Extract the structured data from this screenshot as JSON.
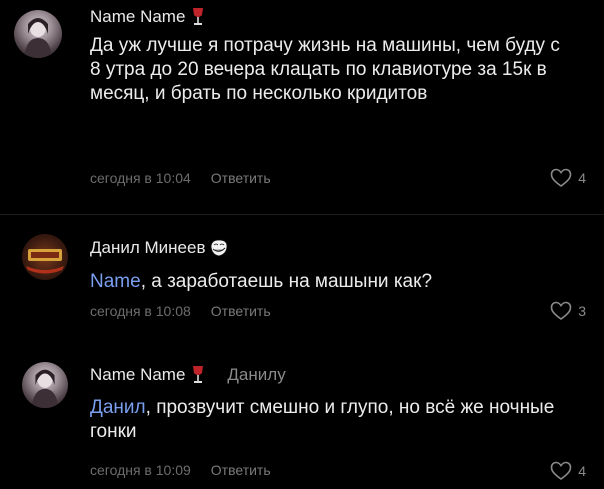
{
  "comments": [
    {
      "author": "Name Name",
      "text": "Да уж лучше я потрачу жизнь на машины, чем буду с 8 утра до 20 вечера клацать по клавиотуре за 15к в месяц, и брать по несколько кридитов",
      "time": "сегодня в 10:04",
      "reply_label": "Ответить",
      "likes": "4"
    },
    {
      "author": "Данил Минеев",
      "mention": "Name",
      "text": ", а заработаешь на машыни как?",
      "time": "сегодня в 10:08",
      "reply_label": "Ответить",
      "likes": "3"
    },
    {
      "author": "Name Name",
      "reply_to": "Данилу",
      "mention": "Данил",
      "text": ", прозвучит смешно и глупо, но всё же ночные гонки",
      "time": "сегодня в 10:09",
      "reply_label": "Ответить",
      "likes": "4"
    }
  ],
  "icons": {
    "wine_glass": "wine-glass-icon",
    "troll_face": "troll-face-icon",
    "heart": "heart-icon"
  },
  "colors": {
    "background": "#000000",
    "mention": "#7a9ff0",
    "meta": "#6d6d6d",
    "wine": "#c0242b"
  }
}
